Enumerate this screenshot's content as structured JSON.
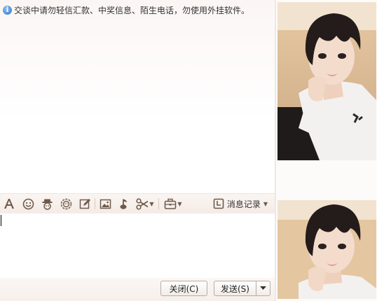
{
  "chat": {
    "notice": "交谈中请勿轻信汇款、中奖信息、陌生电话，勿使用外挂软件。"
  },
  "toolbar": {
    "history_label": "消息记录"
  },
  "buttons": {
    "close_label": "关闭(C)",
    "send_label": "发送(S)"
  },
  "colors": {
    "toolbar_icon": "#6e5a4c",
    "info_icon": "#2a74c9"
  },
  "icons": [
    "font-icon",
    "emoji-icon",
    "magic-face-icon",
    "shake-icon",
    "edit-icon",
    "image-icon",
    "music-icon",
    "scissors-icon",
    "toolbox-icon",
    "history-icon"
  ]
}
